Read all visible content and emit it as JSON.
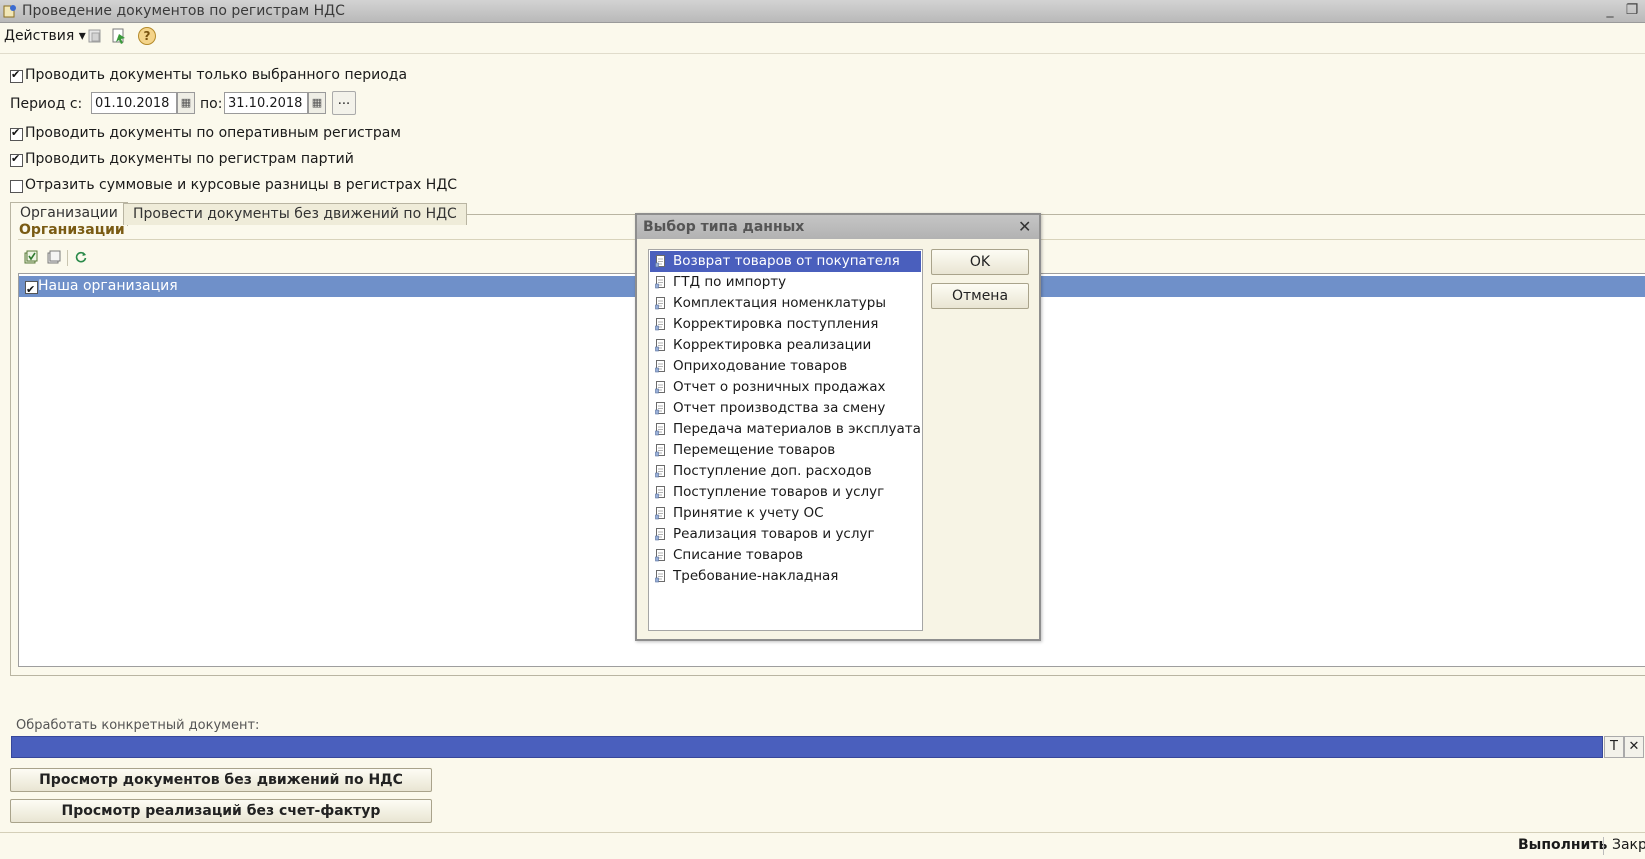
{
  "window": {
    "title": "Проведение документов по регистрам НДС"
  },
  "menu": {
    "actions_label": "Действия"
  },
  "options": {
    "only_period": {
      "label": "Проводить документы только выбранного периода",
      "checked": true
    },
    "period_from_label": "Период с:",
    "period_from": "01.10.2018",
    "period_to_label": "по:",
    "period_to": "31.10.2018",
    "period_dots": "...",
    "operative": {
      "label": "Проводить документы по оперативным регистрам",
      "checked": true
    },
    "parties": {
      "label": "Проводить документы по регистрам партий",
      "checked": true
    },
    "diffs": {
      "label": "Отразить суммовые и курсовые разницы в регистрах НДС",
      "checked": false
    }
  },
  "tabs": [
    {
      "label": "Организации",
      "active": true
    },
    {
      "label": "Провести документы без движений по НДС",
      "active": false
    }
  ],
  "orgs": {
    "section_title": "Организации",
    "rows": [
      {
        "name": "Наша организация",
        "checked": true
      }
    ]
  },
  "document": {
    "label": "Обработать конкретный документ:",
    "type_btn": "T",
    "clear_btn": "✕"
  },
  "buttons": {
    "view_no_moves": "Просмотр документов без движений по НДС",
    "view_no_invoice": "Просмотр реализаций без счет-фактур"
  },
  "footer": {
    "execute": "Выполнить",
    "close": "Закр"
  },
  "dialog": {
    "title": "Выбор типа данных",
    "ok": "OK",
    "cancel": "Отмена",
    "items": [
      "Возврат товаров от покупателя",
      "ГТД по импорту",
      "Комплектация номенклатуры",
      "Корректировка поступления",
      "Корректировка реализации",
      "Оприходование товаров",
      "Отчет о розничных продажах",
      "Отчет производства за смену",
      "Передача материалов в эксплуата...",
      "Перемещение товаров",
      "Поступление доп. расходов",
      "Поступление товаров и услуг",
      "Принятие к учету ОС",
      "Реализация товаров и услуг",
      "Списание товаров",
      "Требование-накладная"
    ],
    "selected_index": 0
  },
  "colors": {
    "background": "#fbf9ec",
    "selection": "#4a5fbd",
    "row_highlight": "#6f90c9",
    "section_title": "#7a5b13"
  }
}
